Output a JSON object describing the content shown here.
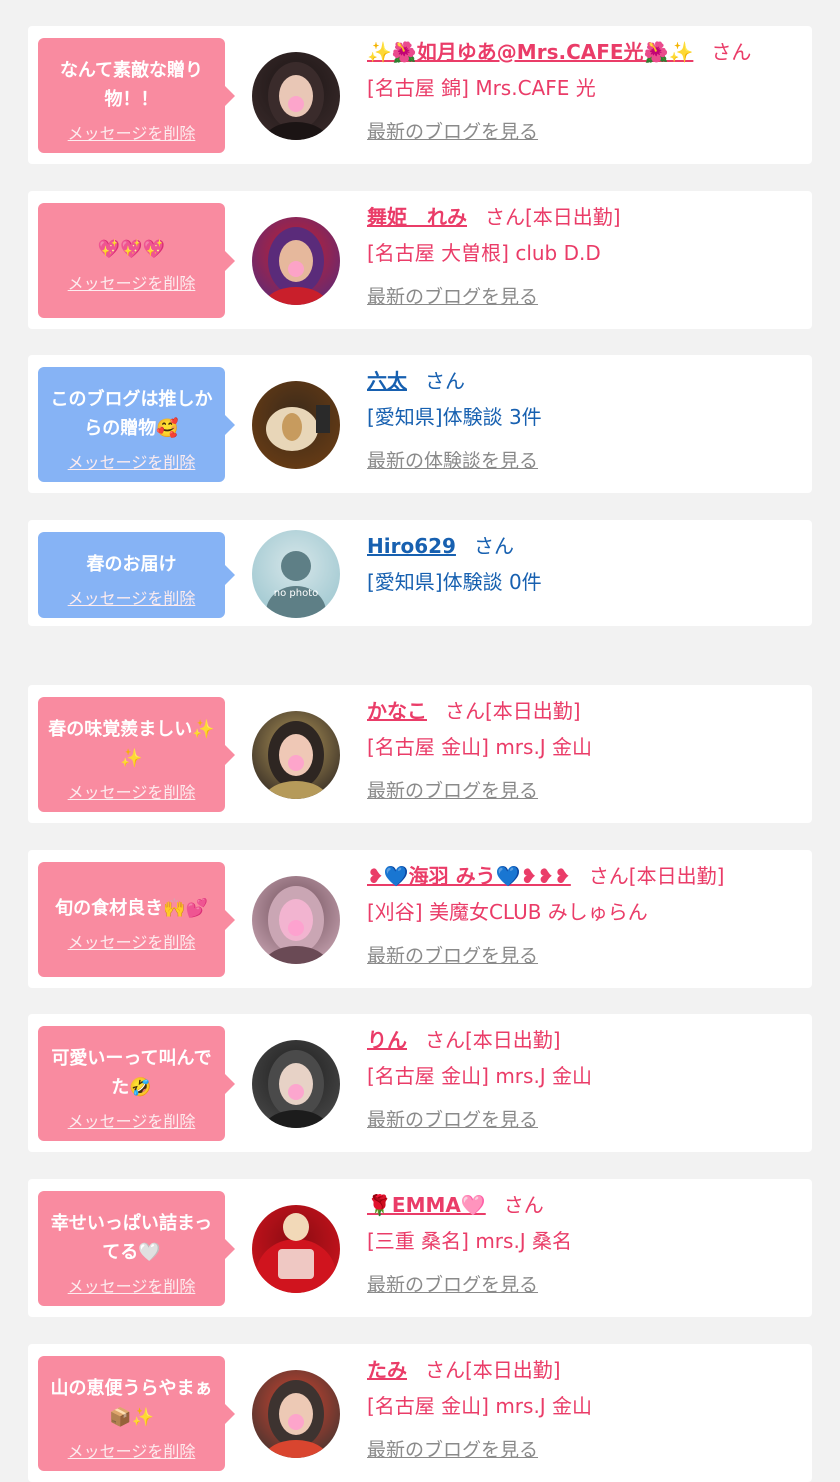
{
  "messages": [
    {
      "bubble_color": "pink",
      "message": "なんて素敵な贈り物！！",
      "delete_label": "メッセージを削除",
      "avatar_icon": "woman-portrait-photo",
      "avatar_palette": [
        "#3a2b2b",
        "#e9c7b6",
        "#1b1414"
      ],
      "name_color": "pink",
      "name": "✨🌺如月ゆあ@Mrs.CAFE光🌺✨",
      "suffix": "さん",
      "shop": "[名古屋 錦] Mrs.CAFE 光",
      "blog_label": "最新のブログを見る"
    },
    {
      "bubble_color": "pink",
      "message": "💖💖💖",
      "delete_label": "メッセージを削除",
      "avatar_icon": "woman-portrait-photo",
      "avatar_palette": [
        "#5a2b7a",
        "#e6b89c",
        "#c91f2b"
      ],
      "name_color": "pink",
      "name": "舞姫　れみ",
      "suffix": "さん[本日出勤]",
      "shop": "[名古屋 大曽根] club D.D",
      "blog_label": "最新のブログを見る"
    },
    {
      "bubble_color": "blue",
      "message": "このブログは推しからの贈物🥰",
      "delete_label": "メッセージを削除",
      "avatar_icon": "food-plate-photo",
      "avatar_palette": [
        "#6b3d14",
        "#e8d6b8",
        "#3b2a1a"
      ],
      "name_color": "blue",
      "name": "六太",
      "suffix": "さん",
      "shop": "[愛知県]体験談 3件",
      "blog_label": "最新の体験談を見る"
    },
    {
      "bubble_color": "blue",
      "message": "春のお届け",
      "delete_label": "メッセージを削除",
      "avatar_icon": "no-photo-silhouette",
      "avatar_palette": [
        "#9cc6cf",
        "#5e7f86",
        "#d6e6e9"
      ],
      "avatar_text": "no photo",
      "name_color": "blue",
      "name": "Hiro629",
      "suffix": "さん",
      "shop": "[愛知県]体験談 0件",
      "blog_label": ""
    },
    {
      "bubble_color": "pink",
      "message": "春の味覚羨ましい✨✨",
      "delete_label": "メッセージを削除",
      "avatar_icon": "woman-portrait-photo",
      "avatar_palette": [
        "#2e2622",
        "#efc8b6",
        "#b59a5a"
      ],
      "name_color": "pink",
      "name": "かなこ",
      "suffix": "さん[本日出勤]",
      "shop": "[名古屋 金山] mrs.J 金山",
      "blog_label": "最新のブログを見る"
    },
    {
      "bubble_color": "pink",
      "message": "旬の食材良き🙌💕",
      "delete_label": "メッセージを削除",
      "avatar_icon": "woman-portrait-photo",
      "avatar_palette": [
        "#caa6b4",
        "#f2b4d0",
        "#6a4a55"
      ],
      "name_color": "pink",
      "name": "❥💙海羽 みう💙❥❥❥",
      "suffix": "さん[本日出勤]",
      "shop": "[刈谷] 美魔女CLUB みしゅらん",
      "blog_label": "最新のブログを見る"
    },
    {
      "bubble_color": "pink",
      "message": "可愛いーって叫んでた🤣",
      "delete_label": "メッセージを削除",
      "avatar_icon": "woman-portrait-photo",
      "avatar_palette": [
        "#4a4a4a",
        "#e7d2c6",
        "#1c1c1c"
      ],
      "name_color": "pink",
      "name": "りん",
      "suffix": "さん[本日出勤]",
      "shop": "[名古屋 金山] mrs.J 金山",
      "blog_label": "最新のブログを見る"
    },
    {
      "bubble_color": "pink",
      "message": "幸せいっぱい詰まってる🤍",
      "delete_label": "メッセージを削除",
      "avatar_icon": "red-shirt-photo",
      "avatar_palette": [
        "#d0141e",
        "#f2d9b8",
        "#8a0c12"
      ],
      "name_color": "pink",
      "name": "🌹EMMA🩷",
      "suffix": "さん",
      "shop": "[三重 桑名] mrs.J 桑名",
      "blog_label": "最新のブログを見る"
    },
    {
      "bubble_color": "pink",
      "message": "山の恵便うらやまぁ📦✨",
      "delete_label": "メッセージを削除",
      "avatar_icon": "woman-portrait-photo",
      "avatar_palette": [
        "#3d3330",
        "#edc9b5",
        "#d9452f"
      ],
      "name_color": "pink",
      "name": "たみ",
      "suffix": "さん[本日出勤]",
      "shop": "[名古屋 金山] mrs.J 金山",
      "blog_label": "最新のブログを見る"
    }
  ]
}
